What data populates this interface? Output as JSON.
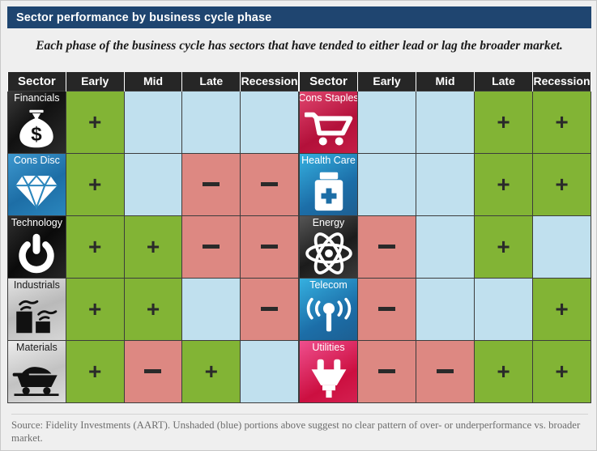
{
  "header": {
    "title": "Sector performance by business cycle phase"
  },
  "subtitle": "Each phase of the business cycle has sectors that have tended to either lead or lag the broader market.",
  "columns": {
    "sector": "Sector",
    "early": "Early",
    "mid": "Mid",
    "late": "Late",
    "recession": "Recession"
  },
  "symbols": {
    "positive": "+",
    "negative": "–",
    "neutral": ""
  },
  "colors": {
    "header_bar": "#1f4570",
    "positive": "#82b435",
    "negative": "#dd8882",
    "neutral": "#c0e0ee",
    "column_header": "#262626",
    "page_background": "#efefef"
  },
  "tables": {
    "left": {
      "rows": [
        {
          "sector": "Financials",
          "icon": "money-bag-icon",
          "early": "positive",
          "mid": "neutral",
          "late": "neutral",
          "recession": "neutral"
        },
        {
          "sector": "Cons Disc",
          "icon": "diamond-icon",
          "early": "positive",
          "mid": "neutral",
          "late": "negative",
          "recession": "negative"
        },
        {
          "sector": "Technology",
          "icon": "power-button-icon",
          "early": "positive",
          "mid": "positive",
          "late": "negative",
          "recession": "negative"
        },
        {
          "sector": "Industrials",
          "icon": "factory-icon",
          "early": "positive",
          "mid": "positive",
          "late": "neutral",
          "recession": "negative"
        },
        {
          "sector": "Materials",
          "icon": "coal-cart-icon",
          "early": "positive",
          "mid": "negative",
          "late": "positive",
          "recession": "neutral"
        }
      ]
    },
    "right": {
      "rows": [
        {
          "sector": "Cons Staples",
          "icon": "shopping-cart-icon",
          "early": "neutral",
          "mid": "neutral",
          "late": "positive",
          "recession": "positive"
        },
        {
          "sector": "Health Care",
          "icon": "medicine-bottle-icon",
          "early": "neutral",
          "mid": "neutral",
          "late": "positive",
          "recession": "positive"
        },
        {
          "sector": "Energy",
          "icon": "atom-icon",
          "early": "negative",
          "mid": "neutral",
          "late": "positive",
          "recession": "neutral"
        },
        {
          "sector": "Telecom",
          "icon": "broadcast-tower-icon",
          "early": "negative",
          "mid": "neutral",
          "late": "neutral",
          "recession": "positive"
        },
        {
          "sector": "Utilities",
          "icon": "power-plug-icon",
          "early": "negative",
          "mid": "negative",
          "late": "positive",
          "recession": "positive"
        }
      ]
    }
  },
  "footer": {
    "source": "Source: Fidelity Investments (AART). Unshaded (blue) portions above suggest no clear pattern of over- or underperformance vs. broader market."
  }
}
